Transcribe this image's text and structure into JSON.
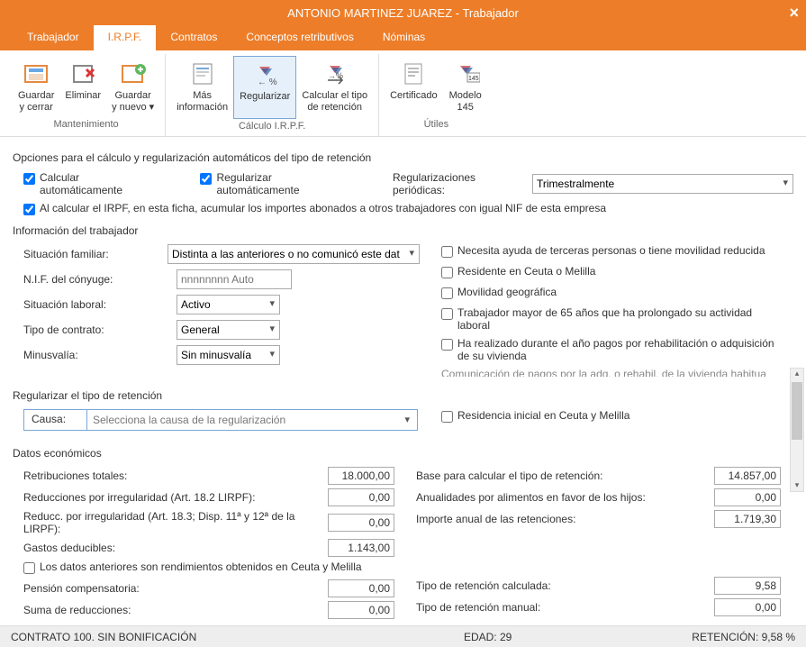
{
  "window": {
    "title": "ANTONIO MARTINEZ JUAREZ - Trabajador"
  },
  "tabs": [
    "Trabajador",
    "I.R.P.F.",
    "Contratos",
    "Conceptos retributivos",
    "Nóminas"
  ],
  "active_tab": 1,
  "ribbon": {
    "groups": [
      {
        "label": "Mantenimiento",
        "buttons": [
          {
            "l1": "Guardar",
            "l2": "y cerrar"
          },
          {
            "l1": "Eliminar",
            "l2": ""
          },
          {
            "l1": "Guardar",
            "l2": "y nuevo ▾"
          }
        ]
      },
      {
        "label": "Cálculo I.R.P.F.",
        "buttons": [
          {
            "l1": "Más",
            "l2": "información"
          },
          {
            "l1": "Regularizar",
            "l2": ""
          },
          {
            "l1": "Calcular el tipo",
            "l2": "de retención"
          }
        ]
      },
      {
        "label": "Útiles",
        "buttons": [
          {
            "l1": "Certificado",
            "l2": ""
          },
          {
            "l1": "Modelo",
            "l2": "145"
          }
        ]
      }
    ]
  },
  "opts": {
    "title": "Opciones para el cálculo y regularización automáticos del tipo de retención",
    "calc_auto_label": "Calcular automáticamente",
    "reg_auto_label": "Regularizar automáticamente",
    "reg_period_label": "Regularizaciones periódicas:",
    "reg_period_value": "Trimestralmente",
    "acum_label": "Al calcular el IRPF, en esta ficha, acumular los importes abonados a otros trabajadores con igual NIF de esta empresa"
  },
  "info": {
    "title": "Información del trabajador",
    "sitfam_label": "Situación familiar:",
    "sitfam_value": "Distinta a las anteriores o no comunicó este dat",
    "nif_label": "N.I.F. del cónyuge:",
    "nif_placeholder": "nnnnnnnn Auto",
    "sitlab_label": "Situación laboral:",
    "sitlab_value": "Activo",
    "tipocon_label": "Tipo de contrato:",
    "tipocon_value": "General",
    "minus_label": "Minusvalía:",
    "minus_value": "Sin minusvalía",
    "chk1": "Necesita ayuda de terceras personas o tiene movilidad reducida",
    "chk2": "Residente en Ceuta o Melilla",
    "chk3": "Movilidad geográfica",
    "chk4": "Trabajador mayor de 65 años que ha prolongado su actividad laboral",
    "chk5": "Ha realizado durante el año pagos por rehabilitación o adquisición de su vivienda",
    "cuttext": "Comunicación de pagos por la adq. o rehabil. de la vivienda habitual"
  },
  "reg": {
    "title": "Regularizar el tipo de retención",
    "causa_label": "Causa:",
    "causa_placeholder": "Selecciona la causa de la regularización",
    "residencia_label": "Residencia inicial en Ceuta y Melilla"
  },
  "econ": {
    "title": "Datos económicos",
    "retrib_label": "Retribuciones totales:",
    "retrib_value": "18.000,00",
    "reducirr_label": "Reducciones por irregularidad (Art. 18.2 LIRPF):",
    "reducirr_value": "0,00",
    "reduc183_label": "Reducc. por irregularidad (Art. 18.3; Disp. 11ª y 12ª de la LIRPF):",
    "reduc183_value": "0,00",
    "gastos_label": "Gastos deducibles:",
    "gastos_value": "1.143,00",
    "ceuta_chk": "Los datos anteriores son rendimientos obtenidos en Ceuta y Melilla",
    "pension_label": "Pensión compensatoria:",
    "pension_value": "0,00",
    "suma_label": "Suma de reducciones:",
    "suma_value": "0,00",
    "base_label": "Base para calcular el tipo de retención:",
    "base_value": "14.857,00",
    "anual_label": "Anualidades por alimentos en favor de los hijos:",
    "anual_value": "0,00",
    "importe_label": "Importe anual de las retenciones:",
    "importe_value": "1.719,30",
    "tipocalc_label": "Tipo de retención calculada:",
    "tipocalc_value": "9,58",
    "tipoman_label": "Tipo de retención manual:",
    "tipoman_value": "0,00"
  },
  "status": {
    "contrato": "CONTRATO 100.  SIN BONIFICACIÓN",
    "edad": "EDAD: 29",
    "retencion": "RETENCIÓN: 9,58 %"
  }
}
